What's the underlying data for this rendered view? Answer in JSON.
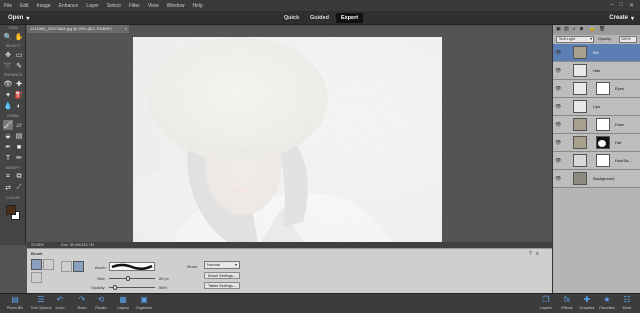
{
  "menubar": {
    "items": [
      "File",
      "Edit",
      "Image",
      "Enhance",
      "Layer",
      "Select",
      "Filter",
      "View",
      "Window",
      "Help"
    ]
  },
  "modebar": {
    "open_label": "Open",
    "create_label": "Create",
    "tabs": [
      {
        "label": "Quick",
        "active": false
      },
      {
        "label": "Guided",
        "active": false
      },
      {
        "label": "Expert",
        "active": true
      }
    ]
  },
  "toolbox": {
    "sections": [
      "VIEW",
      "SELECT",
      "ENHANCE",
      "DRAW",
      "MODIFY",
      "COLOR"
    ]
  },
  "document": {
    "tab_title": "1415360_20571664.jpg @ 25% (BG, RGB/8*)",
    "zoom": "22.68%",
    "doc_size": "Doc: 30.0M/116.7M"
  },
  "tool_options": {
    "tool_name": "Brush",
    "brush_label": "Brush:",
    "size_label": "Size:",
    "size_value": "80 px",
    "size_fraction": 0.42,
    "opacity_label": "Opacity:",
    "opacity_value": "56%",
    "opacity_fraction": 0.12,
    "mode_label": "Mode:",
    "mode_value": "Normal",
    "brush_settings_label": "Brush Settings...",
    "tablet_settings_label": "Tablet Settings..."
  },
  "layers": {
    "blend_mode": "Soft Light",
    "opacity_label": "Opacity:",
    "opacity_value": "100%",
    "items": [
      {
        "name": "BG",
        "selected": true
      },
      {
        "name": "Hair",
        "selected": false
      },
      {
        "name": "Eyes",
        "selected": false
      },
      {
        "name": "Lips",
        "selected": false
      },
      {
        "name": "Face",
        "selected": false
      },
      {
        "name": "Hat",
        "selected": false
      },
      {
        "name": "Hue/Sa...",
        "selected": false
      },
      {
        "name": "Background",
        "selected": false
      }
    ]
  },
  "bottombar": {
    "left": [
      {
        "label": "Photo Bin",
        "icon": "photo-bin-icon"
      },
      {
        "label": "Tool Options",
        "icon": "tool-options-icon"
      },
      {
        "label": "Undo",
        "icon": "undo-icon"
      },
      {
        "label": "Redo",
        "icon": "redo-icon"
      },
      {
        "label": "Rotate",
        "icon": "rotate-icon"
      },
      {
        "label": "Layout",
        "icon": "layout-icon"
      },
      {
        "label": "Organizer",
        "icon": "organizer-icon"
      }
    ],
    "right": [
      {
        "label": "Layers",
        "icon": "layers-icon"
      },
      {
        "label": "Effects",
        "icon": "effects-icon"
      },
      {
        "label": "Graphics",
        "icon": "graphics-icon"
      },
      {
        "label": "Favorites",
        "icon": "favorites-icon"
      },
      {
        "label": "More",
        "icon": "more-icon"
      }
    ]
  },
  "colors": {
    "foreground": "#4a2e1a",
    "background": "#ffffff",
    "accent": "#5aa0e8",
    "selected_layer": "#5b7fb5"
  }
}
